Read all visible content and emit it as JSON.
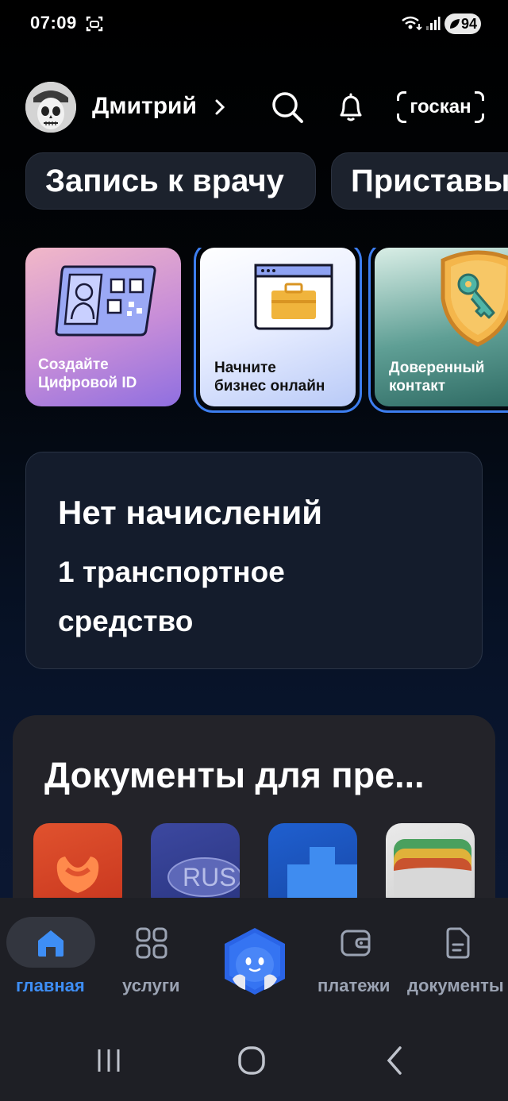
{
  "status_bar": {
    "time": "07:09",
    "battery": "94"
  },
  "header": {
    "user_name": "Дмитрий",
    "goscan_label": "госкан"
  },
  "quick_chips": [
    {
      "label": "Запись к врачу"
    },
    {
      "label": "Приставы"
    }
  ],
  "stories": [
    {
      "label_line1": "Создайте",
      "label_line2": "Цифровой ID",
      "icon": "digital-id-card-icon"
    },
    {
      "label_line1": "Начните",
      "label_line2": "бизнес онлайн",
      "icon": "briefcase-window-icon"
    },
    {
      "label_line1": "Доверенный",
      "label_line2": "контакт",
      "icon": "key-shield-icon"
    }
  ],
  "fines_card": {
    "title": "Нет начислений",
    "subtitle": "1 транспортное средство"
  },
  "documents": {
    "title": "Документы для пре...",
    "tiles": [
      {
        "icon": "hand-emblem-icon"
      },
      {
        "icon": "rus-plate-icon",
        "text": "RUS"
      },
      {
        "icon": "blue-block-icon"
      },
      {
        "icon": "wallet-cards-icon"
      }
    ]
  },
  "tabbar": {
    "home": "главная",
    "services": "услуги",
    "payments": "платежи",
    "documents": "документы"
  },
  "colors": {
    "accent": "#3e8ef5",
    "story_border": "#3d7ef0",
    "card_bg": "#141c2c",
    "tabbar_bg": "#1e1f25"
  }
}
